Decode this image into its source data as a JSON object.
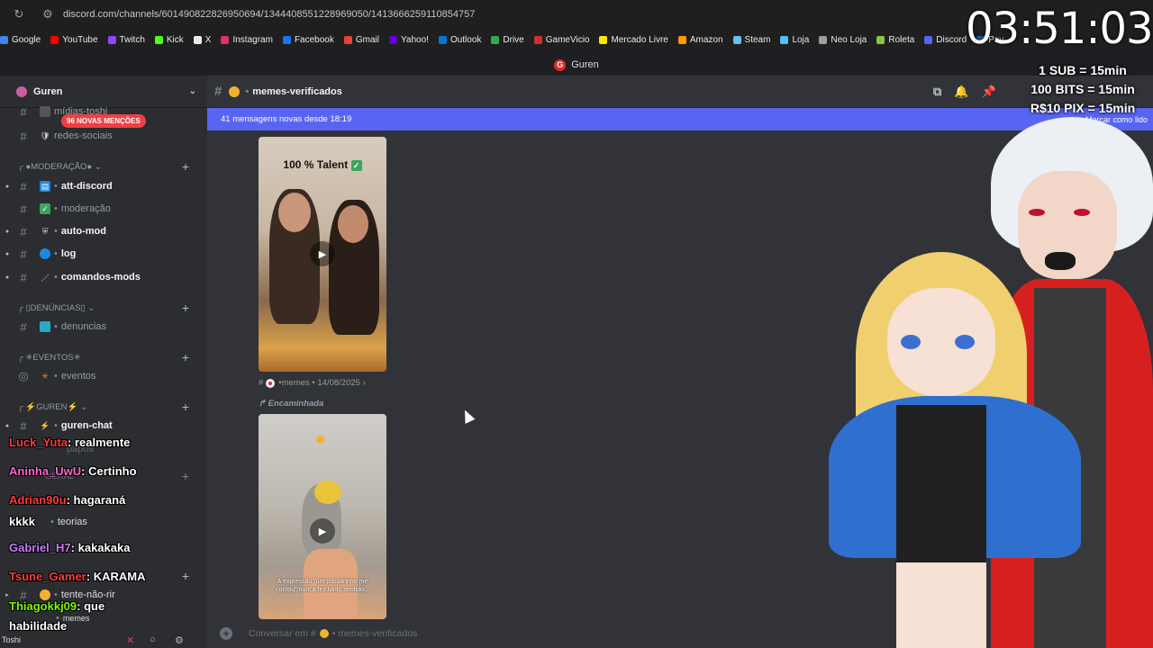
{
  "browser": {
    "url": "discord.com/channels/601490822826950694/1344408551228969050/1413666259110854757",
    "bookmarks": [
      {
        "label": "Google",
        "color": "#4285f4"
      },
      {
        "label": "YouTube",
        "color": "#ff0000"
      },
      {
        "label": "Twitch",
        "color": "#9146ff"
      },
      {
        "label": "Kick",
        "color": "#53fc18"
      },
      {
        "label": "X",
        "color": "#e8eaed"
      },
      {
        "label": "Instagram",
        "color": "#e1306c"
      },
      {
        "label": "Facebook",
        "color": "#1877f2"
      },
      {
        "label": "Gmail",
        "color": "#ea4335"
      },
      {
        "label": "Yahoo!",
        "color": "#6001d2"
      },
      {
        "label": "Outlook",
        "color": "#0078d4"
      },
      {
        "label": "Drive",
        "color": "#34a853"
      },
      {
        "label": "GameVicio",
        "color": "#d32f2f"
      },
      {
        "label": "Mercado Livre",
        "color": "#ffe600"
      },
      {
        "label": "Amazon",
        "color": "#ff9900"
      },
      {
        "label": "Steam",
        "color": "#66c0f4"
      },
      {
        "label": "Loja",
        "color": "#4fc3f7"
      },
      {
        "label": "Neo Loja",
        "color": "#9e9e9e"
      },
      {
        "label": "Roleta",
        "color": "#8bc34a"
      },
      {
        "label": "Discord",
        "color": "#5865f2"
      },
      {
        "label": "Pay",
        "color": "#1565c0"
      }
    ]
  },
  "app": {
    "title": "Guren"
  },
  "sidebar": {
    "server_name": "Guren",
    "mention_badge": "96 NOVAS MENÇÕES",
    "partial_top": "mídias-toshi",
    "channels": [
      {
        "label": "redes-sociais",
        "unread": false,
        "emoji": "🛡"
      },
      {
        "label": "att-discord",
        "unread": true,
        "emoji": "📰"
      },
      {
        "label": "moderação",
        "unread": false,
        "emoji": "✅"
      },
      {
        "label": "auto-mod",
        "unread": true,
        "emoji": "🛡"
      },
      {
        "label": "log",
        "unread": true,
        "emoji": "🌐"
      },
      {
        "label": "comandos-mods",
        "unread": true,
        "emoji": "／"
      },
      {
        "label": "denuncias",
        "unread": false,
        "emoji": "📺"
      },
      {
        "label": "eventos",
        "unread": false,
        "emoji": "✳"
      },
      {
        "label": "guren-chat",
        "unread": true,
        "emoji": "⚡"
      },
      {
        "label": "papos",
        "unread": false,
        "emoji": ""
      },
      {
        "label": "teorias",
        "unread": false,
        "emoji": ""
      },
      {
        "label": "tente-não-rir",
        "unread": false,
        "emoji": "😂"
      },
      {
        "label": "memes",
        "unread": false,
        "emoji": ""
      }
    ],
    "categories": [
      "MODERAÇÃO",
      "DENÚNCIAS",
      "EVENTOS",
      "GUREN",
      "GERAL"
    ],
    "username": "Toshi"
  },
  "channel": {
    "name": "memes-verificados",
    "new_messages": "41 mensagens novas desde 18:19",
    "mark_read": "Marcar como lido"
  },
  "messages": {
    "video1_title": "100 % Talent",
    "meta_channel": "memes",
    "meta_date": "14/08/2025",
    "forwarded_label": "Encaminhada",
    "video2_caption": "A expressão \"um passarinho me contou\" nunca fez tanto sentido..."
  },
  "composer": {
    "placeholder_prefix": "Conversar em #",
    "placeholder_channel": "memes-verificados"
  },
  "stream": {
    "timer": "03:51:03",
    "rates": [
      "1 SUB = 15min",
      "100 BITS = 15min",
      "R$10 PIX = 15min"
    ],
    "chat": [
      {
        "user": "Luck_Yuta",
        "text": "realmente",
        "color": "#ff3c3c"
      },
      {
        "user": "Aninha_UwU",
        "text": "Certinho",
        "color": "#ff66cc"
      },
      {
        "user": "Adrian90u",
        "text": "hagaraná",
        "color": "#ff3c3c"
      },
      {
        "user": "",
        "text": "kkkk",
        "color": "#ffffff"
      },
      {
        "user": "Gabriel_H7",
        "text": "kakakaka",
        "color": "#c77dff"
      },
      {
        "user": "Tsune_Gamer",
        "text": "KARAMA",
        "color": "#ff3c3c"
      },
      {
        "user": "Thiagokkj09",
        "text": "que",
        "color": "#7cfc00"
      },
      {
        "user": "",
        "text": "habilidade",
        "color": "#ffffff"
      }
    ]
  }
}
